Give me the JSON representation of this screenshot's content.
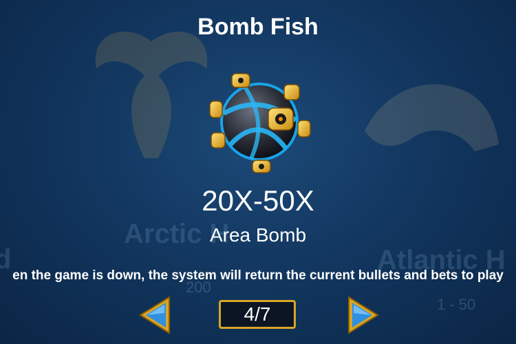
{
  "title": "Bomb Fish",
  "multiplier": "20X-50X",
  "bomb_type": "Area Bomb",
  "notice": "en the game is down, the system will return the current bullets and bets to play",
  "pagination": {
    "current": "4/7"
  },
  "background_texts": [
    "Arctic H",
    "Atlantic H",
    "d",
    "200",
    "1 - 50"
  ],
  "icons": {
    "fish": "bomb-fish-icon",
    "prev": "arrow-left-icon",
    "next": "arrow-right-icon"
  },
  "colors": {
    "background": "#123760",
    "frame_gold": "#d9a526",
    "arrow_blue": "#2f8fe0",
    "text": "#ffffff"
  }
}
